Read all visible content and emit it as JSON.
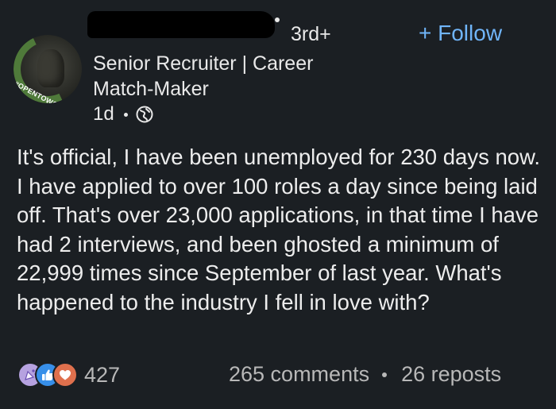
{
  "author": {
    "degree": "3rd+",
    "headline": "Senior Recruiter | Career Match-Maker",
    "time": "1d",
    "badge": "#OPENTOWORK"
  },
  "actions": {
    "follow_label": "+ Follow"
  },
  "post": {
    "body": "It's official, I have been unemployed for 230 days now. I have applied to over 100 roles a day since being laid off. That's over 23,000 applications, in that time I have had 2 interviews, and been ghosted a minimum of 22,999 times since September of last year. What's happened to the industry I fell in love with?"
  },
  "social": {
    "reactions_count": "427",
    "comments": "265 comments",
    "reposts": "26 reposts",
    "reaction_icons": [
      "celebrate-icon",
      "like-icon",
      "love-icon"
    ]
  },
  "colors": {
    "background": "#1b1f23",
    "accent": "#70b5f9",
    "open_to_work_frame": "#4f7a3a",
    "like": "#378fe9",
    "love": "#df704d",
    "celebrate": "#b6a2e0"
  }
}
